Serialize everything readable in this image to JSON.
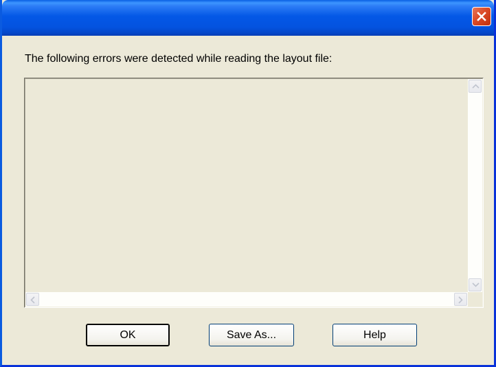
{
  "dialog": {
    "message": "The following errors were detected while reading the layout file:",
    "error_list": []
  },
  "buttons": {
    "ok": "OK",
    "save_as": "Save As...",
    "help": "Help"
  },
  "icons": {
    "close": "close-icon",
    "scroll_up": "arrow-up-icon",
    "scroll_down": "arrow-down-icon",
    "scroll_left": "arrow-left-icon",
    "scroll_right": "arrow-right-icon"
  },
  "colors": {
    "titlebar": "#0458E6",
    "dialog_background": "#ECE9D8",
    "close_button": "#DB4A26",
    "button_border": "#003C74"
  }
}
